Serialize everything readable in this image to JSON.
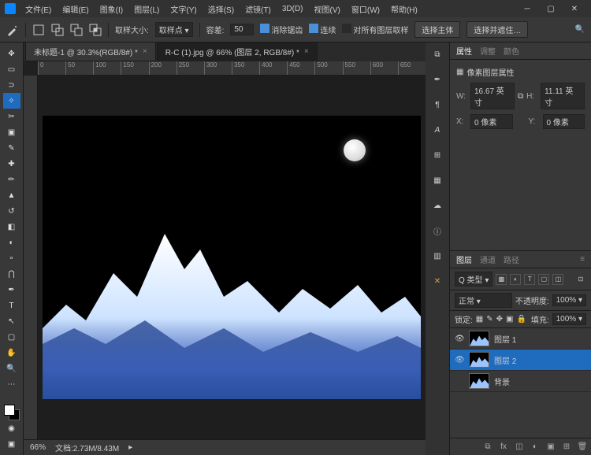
{
  "menu": {
    "file": "文件(E)",
    "edit": "编辑(E)",
    "image": "图象(I)",
    "layer": "图层(L)",
    "type": "文字(Y)",
    "select": "选择(S)",
    "filter": "滤镜(T)",
    "3d": "3D(D)",
    "view": "视图(V)",
    "window": "窗口(W)",
    "help": "帮助(H)"
  },
  "options": {
    "sample_label": "取样大小:",
    "sample_val": "取样点",
    "tolerance_label": "容差:",
    "tolerance_val": "50",
    "antialias": "消除锯齿",
    "contiguous": "连续",
    "all_layers": "对所有图层取样",
    "select_subject": "选择主体",
    "select_and_mask": "选择并遮住…"
  },
  "tabs": [
    {
      "title": "未标题-1 @ 30.3%(RGB/8#) *"
    },
    {
      "title": "R-C (1).jpg @ 66% (图层 2, RGB/8#) *"
    }
  ],
  "ruler_marks": [
    "0",
    "50",
    "100",
    "150",
    "200",
    "250",
    "300",
    "350",
    "400",
    "450",
    "500",
    "550",
    "600",
    "650"
  ],
  "status": {
    "zoom": "66%",
    "doc": "文档:2.73M/8.43M"
  },
  "propPanel": {
    "tabs": {
      "properties": "属性",
      "adjust": "调整",
      "color": "颜色"
    },
    "title": "像素图层属性",
    "w_label": "W:",
    "w_val": "16.67 英寸",
    "h_label": "H:",
    "h_val": "11.11 英寸",
    "x_label": "X:",
    "x_val": "0 像素",
    "y_label": "Y:",
    "y_val": "0 像素"
  },
  "layerPanel": {
    "tabs": {
      "layers": "图层",
      "channels": "通道",
      "paths": "路径"
    },
    "kind": "Q 类型",
    "blend": "正常",
    "opacity_label": "不透明度:",
    "opacity": "100%",
    "lock_label": "锁定:",
    "fill_label": "填充:",
    "fill": "100%",
    "layers": [
      {
        "name": "图层 1",
        "visible": true,
        "sel": false
      },
      {
        "name": "图层 2",
        "visible": true,
        "sel": true
      },
      {
        "name": "背景",
        "visible": false,
        "sel": false
      }
    ]
  }
}
